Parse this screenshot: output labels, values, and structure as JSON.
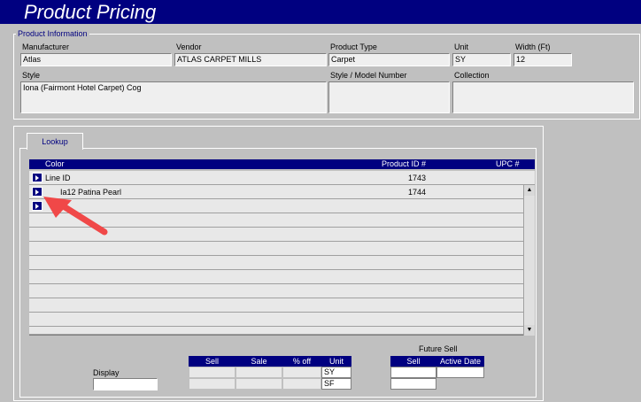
{
  "window": {
    "title": "Product Pricing"
  },
  "product_info": {
    "group_label": "Product Information",
    "manufacturer": {
      "label": "Manufacturer",
      "value": "Atlas"
    },
    "vendor": {
      "label": "Vendor",
      "value": "ATLAS CARPET MILLS"
    },
    "product_type": {
      "label": "Product Type",
      "value": "Carpet"
    },
    "unit": {
      "label": "Unit",
      "value": "SY"
    },
    "width": {
      "label": "Width (Ft)",
      "value": "12"
    },
    "style": {
      "label": "Style",
      "value": "Iona (Fairmont Hotel Carpet) Cog"
    },
    "style_model": {
      "label": "Style / Model Number",
      "value": ""
    },
    "collection": {
      "label": "Collection",
      "value": ""
    }
  },
  "lookup": {
    "tab_label": "Lookup",
    "columns": [
      "Color",
      "Product ID #",
      "UPC #"
    ],
    "rows": [
      {
        "color": "Line ID",
        "product_id": "1743",
        "upc": ""
      },
      {
        "color": "Ia12 Patina Pearl",
        "product_id": "1744",
        "upc": ""
      },
      {
        "color": "",
        "product_id": "",
        "upc": ""
      }
    ]
  },
  "pricing": {
    "display_label": "Display",
    "display_value": "",
    "columns": [
      "Sell",
      "Sale",
      "% off",
      "Unit"
    ],
    "rows": [
      {
        "sell": "",
        "sale": "",
        "pct_off": "",
        "unit": "SY"
      },
      {
        "sell": "",
        "sale": "",
        "pct_off": "",
        "unit": "SF"
      }
    ],
    "future_sell": {
      "label": "Future Sell",
      "columns": [
        "Sell",
        "Active Date"
      ],
      "sell": "",
      "active_date": ""
    }
  },
  "colors": {
    "title_bar": "#000080",
    "background": "#c0c0c0",
    "annotation_arrow": "#f04848"
  }
}
